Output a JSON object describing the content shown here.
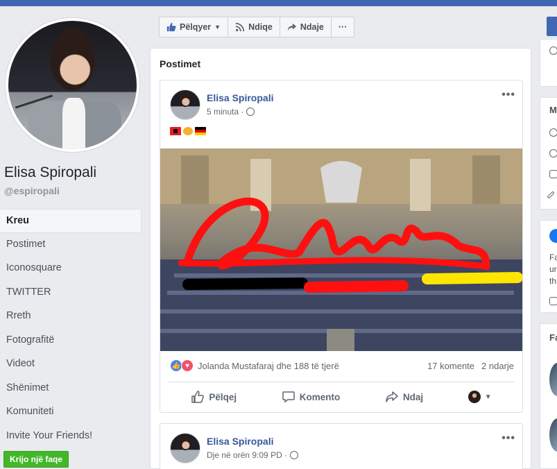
{
  "profile": {
    "name": "Elisa Spiropali",
    "handle": "@espiropali"
  },
  "nav": [
    {
      "label": "Kreu",
      "active": true
    },
    {
      "label": "Postimet"
    },
    {
      "label": "Iconosquare"
    },
    {
      "label": "TWITTER"
    },
    {
      "label": "Rreth"
    },
    {
      "label": "Fotografitë"
    },
    {
      "label": "Videot"
    },
    {
      "label": "Shënimet"
    },
    {
      "label": "Komuniteti"
    },
    {
      "label": "Invite Your Friends!"
    }
  ],
  "create_page_label": "Krijo një faqe",
  "action_bar": {
    "like_label": "Pëlqyer",
    "follow_label": "Ndiqe",
    "share_label": "Ndaje",
    "more_label": "···"
  },
  "posts_section_title": "Postimet",
  "post1": {
    "author": "Elisa Spiropali",
    "time": "5 minuta ·",
    "image_caption": "Danke",
    "reactions_text": "Jolanda Mustafaraj dhe 188 të tjerë",
    "comments": "17 komente",
    "shares": "2 ndarje",
    "like_label": "Pëlqej",
    "comment_label": "Komento",
    "share_label": "Ndaj"
  },
  "post2": {
    "author": "Elisa Spiropali",
    "time": "Dje në orën 9:09 PD ·"
  },
  "right_col": {
    "card2_letter": "M",
    "card3_lines": [
      "Fa",
      "ur",
      "th"
    ],
    "card4_letter": "Fa"
  },
  "colors": {
    "brand_blue": "#4267b2",
    "link_blue": "#365899",
    "create_green": "#42b72a"
  }
}
